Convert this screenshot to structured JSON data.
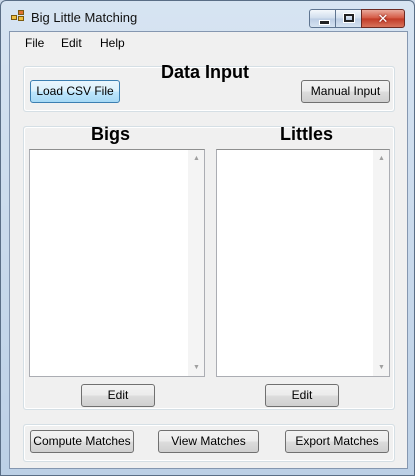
{
  "window": {
    "title": "Big Little Matching",
    "close_glyph": "✕"
  },
  "menu": [
    "File",
    "Edit",
    "Help"
  ],
  "data_input": {
    "heading": "Data Input",
    "load_button": "Load CSV File",
    "manual_button": "Manual Input"
  },
  "bigs": {
    "heading": "Bigs",
    "edit_button": "Edit",
    "items": []
  },
  "littles": {
    "heading": "Littles",
    "edit_button": "Edit",
    "items": []
  },
  "scroll": {
    "up": "▲",
    "down": "▼"
  },
  "actions": {
    "compute": "Compute Matches",
    "view": "View Matches",
    "export": "Export Matches"
  },
  "icons": {
    "app": "app-icon",
    "minimize": "minimize-icon",
    "maximize": "maximize-icon",
    "close": "close-icon"
  }
}
